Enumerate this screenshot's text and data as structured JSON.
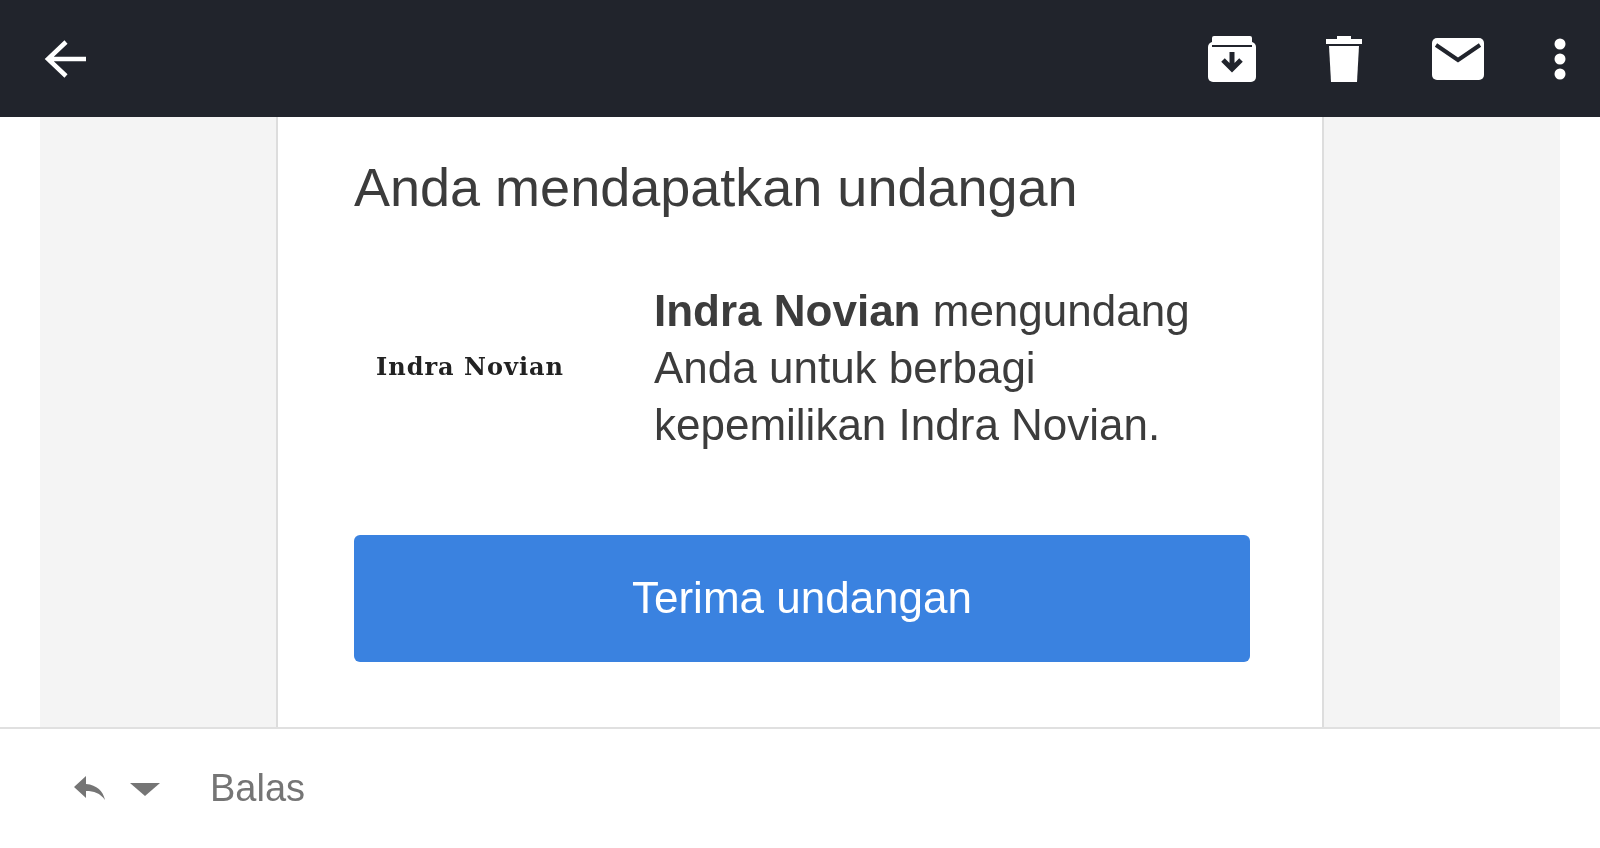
{
  "toolbar": {
    "actions": [
      {
        "kind": "archive"
      },
      {
        "kind": "delete"
      },
      {
        "kind": "mail"
      },
      {
        "kind": "more"
      }
    ]
  },
  "message": {
    "title": "Anda mendapatkan undangan",
    "logo_text": "Indra Novian",
    "body": "**Indra Novian** mengundang Anda untuk berbagi kepemilikan Indra Novian.",
    "button": "Terima undangan"
  },
  "reply_bar": {
    "label": "Balas"
  }
}
